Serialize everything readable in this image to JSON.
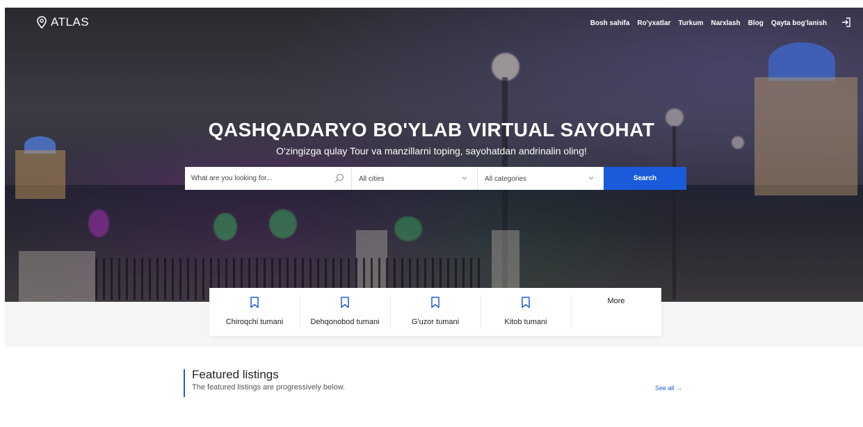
{
  "brand": {
    "name": "ATLAS",
    "icon": "location-pin-icon"
  },
  "nav": {
    "items": [
      {
        "label": "Bosh sahifa"
      },
      {
        "label": "Ro'yxatlar"
      },
      {
        "label": "Turkum"
      },
      {
        "label": "Narxlash"
      },
      {
        "label": "Blog"
      },
      {
        "label": "Qayta bog'lanish"
      }
    ],
    "login_icon": "sign-in-icon"
  },
  "hero": {
    "title": "QASHQADARYO BO'YLAB VIRTUAL SAYOHAT",
    "subtitle": "O'zingizga qulay Tour va manzillarni toping, sayohatdan andrinalin oling!"
  },
  "search": {
    "placeholder": "What are you looking for...",
    "city_select": "All cities",
    "category_select": "All categories",
    "button_label": "Search"
  },
  "categories": [
    {
      "label": "Chiroqchi tumani",
      "icon": "bookmark-icon"
    },
    {
      "label": "Dehqonobod tumani",
      "icon": "bookmark-icon"
    },
    {
      "label": "G'uzor tumani",
      "icon": "bookmark-icon"
    },
    {
      "label": "Kitob tumani",
      "icon": "bookmark-icon"
    },
    {
      "label": "More"
    }
  ],
  "featured": {
    "title": "Featured listings",
    "subtitle": "The featured listings are progressively below.",
    "see_all": "See all →"
  },
  "colors": {
    "accent": "#1a5bdb",
    "band": "#f5f5f5"
  }
}
